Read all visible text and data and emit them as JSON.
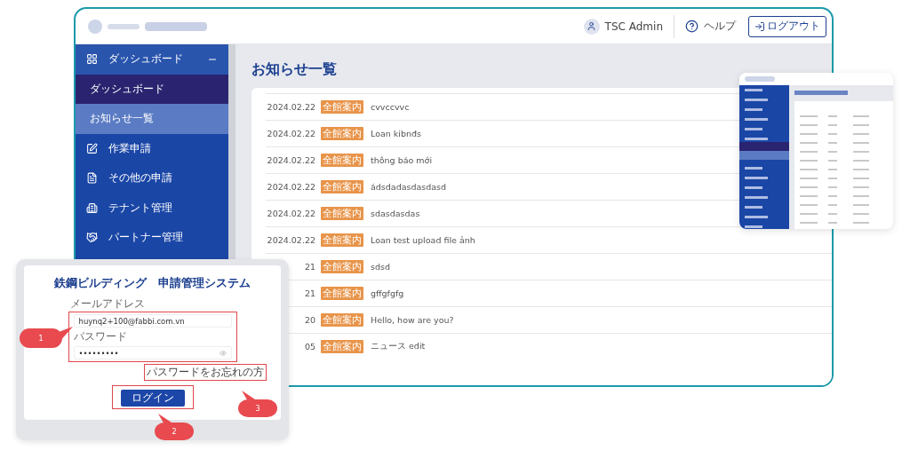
{
  "main_window": {
    "header": {
      "user": "TSC Admin",
      "help": "ヘルプ",
      "logout": "ログアウト"
    },
    "sidebar": [
      {
        "label": "ダッシュボード",
        "kind": "group",
        "expanded": true,
        "children": [
          {
            "label": "ダッシュボード",
            "selected": false
          },
          {
            "label": "お知らせ一覧",
            "selected": true
          }
        ]
      },
      {
        "label": "作業申請",
        "kind": "item"
      },
      {
        "label": "その他の申請",
        "kind": "item"
      },
      {
        "label": "テナント管理",
        "kind": "item"
      },
      {
        "label": "パートナー管理",
        "kind": "item"
      }
    ],
    "page_title": "お知らせ一覧",
    "notices": [
      {
        "date": "2024.02.22",
        "tag": "全館案内",
        "title": "cvvccvvc"
      },
      {
        "date": "2024.02.22",
        "tag": "全館案内",
        "title": "Loan kibnđs"
      },
      {
        "date": "2024.02.22",
        "tag": "全館案内",
        "title": "thông báo mới"
      },
      {
        "date": "2024.02.22",
        "tag": "全館案内",
        "title": "ádsdadasdasdasd"
      },
      {
        "date": "2024.02.22",
        "tag": "全館案内",
        "title": "sdasdasdas"
      },
      {
        "date": "2024.02.22",
        "tag": "全館案内",
        "title": "Loan test upload file ảnh"
      },
      {
        "date": "21",
        "tag": "全館案内",
        "title": "sdsd"
      },
      {
        "date": "21",
        "tag": "全館案内",
        "title": "gffgfgfg"
      },
      {
        "date": "20",
        "tag": "全館案内",
        "title": "Hello, how are you?"
      },
      {
        "date": "05",
        "tag": "全館案内",
        "title": "ニュース edit"
      }
    ]
  },
  "login_dialog": {
    "title": "鉄鋼ビルディング　申請管理システム",
    "email_label": "メールアドレス",
    "email_value": "huynq2+100@fabbi.com.vn",
    "password_label": "パスワード",
    "password_value": "•••••••••",
    "forgot_link": "パスワードをお忘れの方",
    "login_button": "ログイン"
  },
  "callouts": [
    {
      "number": "1"
    },
    {
      "number": "2"
    },
    {
      "number": "3"
    }
  ]
}
